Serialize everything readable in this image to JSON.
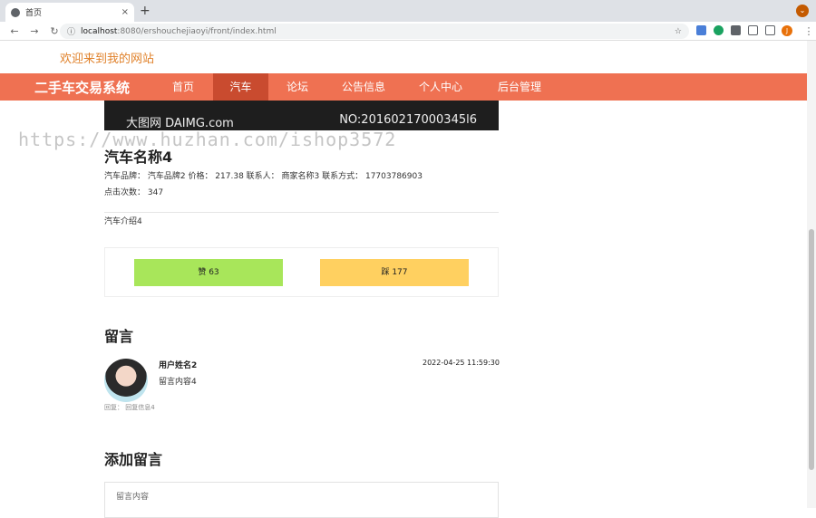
{
  "browser": {
    "tab_title": "首页",
    "tab_close": "×",
    "new_tab": "+",
    "url_host": "localhost",
    "url_rest": ":8080/ershouchejiaoyi/front/index.html",
    "profile_initial": "J"
  },
  "site": {
    "welcome": "欢迎来到我的网站",
    "brand": "二手车交易系统",
    "nav": [
      "首页",
      "汽车",
      "论坛",
      "公告信息",
      "个人中心",
      "后台管理"
    ],
    "active_nav": "汽车",
    "accent_color": "#ef7152"
  },
  "banner": {
    "left_text": "大图网 DAIMG.com",
    "right_text": "NO:20160217000345l6"
  },
  "watermark": "https://www.huzhan.com/ishop3572",
  "car": {
    "title": "汽车名称4",
    "info_line1": "汽车品牌：  汽车品牌2   价格：  217.38   联系人：  商家名称3   联系方式：  17703786903",
    "info_line2": "点击次数：  347",
    "intro": "汽车介绍4"
  },
  "votes": {
    "like_label": "赞     63",
    "dislike_label": "踩     177",
    "like": 63,
    "dislike": 177
  },
  "comments": {
    "section_title": "留言",
    "items": [
      {
        "user": "用户姓名2",
        "content": "留言内容4",
        "time": "2022-04-25 11:59:30",
        "reply": "回复：  回复信息4"
      }
    ]
  },
  "add_comment": {
    "section_title": "添加留言",
    "placeholder": "留言内容"
  }
}
